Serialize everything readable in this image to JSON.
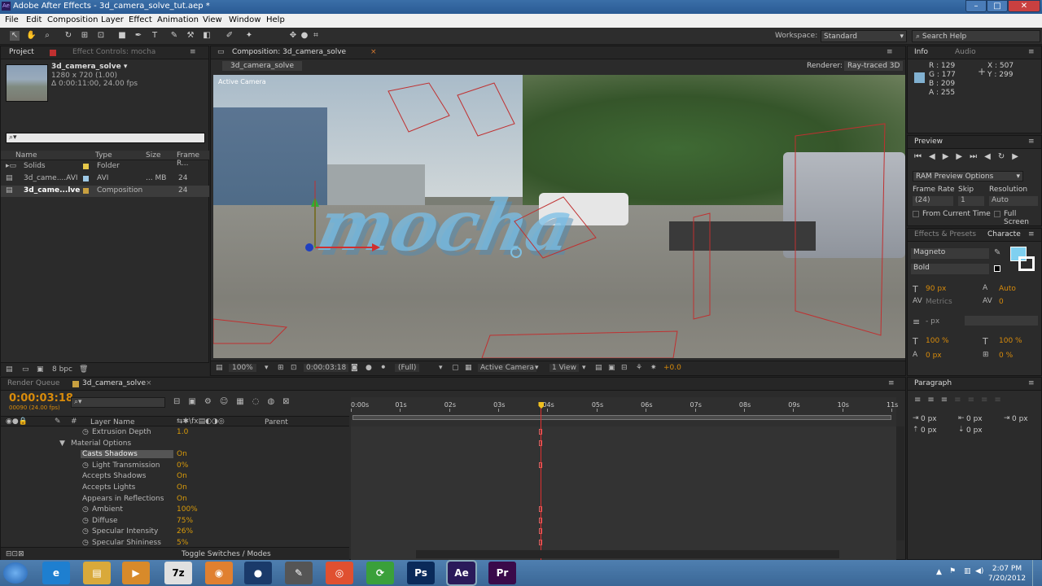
{
  "window": {
    "title": "Adobe After Effects - 3d_camera_solve_tut.aep *",
    "minimize": "–",
    "maximize": "□",
    "close": "✕"
  },
  "menu": [
    "File",
    "Edit",
    "Composition",
    "Layer",
    "Effect",
    "Animation",
    "View",
    "Window",
    "Help"
  ],
  "workspace": {
    "label": "Workspace:",
    "value": "Standard",
    "search_placeholder": "Search Help"
  },
  "project": {
    "tab1": "Project",
    "tab2": "Effect Controls: mocha",
    "comp_name": "3d_camera_solve ▾",
    "comp_info1": "1280 x 720 (1.00)",
    "comp_info2": "Δ 0:00:11:00, 24.00 fps",
    "headers": [
      "Name",
      "Type",
      "Size",
      "Frame R..."
    ],
    "items": [
      {
        "name": "Solids",
        "type": "Folder",
        "size": "",
        "fr": "",
        "color": "#e6c84a"
      },
      {
        "name": "3d_came....AVI",
        "type": "AVI",
        "size": "... MB",
        "fr": "24",
        "color": "#9ec9e6"
      },
      {
        "name": "3d_came...lve",
        "type": "Composition",
        "size": "",
        "fr": "24",
        "color": "#c8a040"
      }
    ],
    "bpc": "8 bpc"
  },
  "comp": {
    "tab": "Composition: 3d_camera_solve",
    "subtab": "3d_camera_solve",
    "renderer_label": "Renderer:",
    "renderer": "Ray-traced 3D",
    "active_camera": "Active Camera",
    "overlay_text": "mocha",
    "footer": {
      "zoom": "100%",
      "time": "0:00:03:18",
      "res": "(Full)",
      "camera": "Active Camera",
      "view": "1 View",
      "exposure": "+0.0"
    }
  },
  "info": {
    "tab1": "Info",
    "tab2": "Audio",
    "r": "R : 129",
    "g": "G : 177",
    "b": "B : 209",
    "a": "A : 255",
    "x": "X : 507",
    "y": "Y : 299",
    "swatch": "#81b1d1"
  },
  "preview": {
    "tab": "Preview",
    "ram": "RAM Preview Options",
    "frame_rate_label": "Frame Rate",
    "skip_label": "Skip",
    "resolution_label": "Resolution",
    "frame_rate": "(24)",
    "skip": "1",
    "resolution": "Auto",
    "from_current": "From Current Time",
    "full_screen": "Full Screen"
  },
  "character": {
    "tab1": "Effects & Presets",
    "tab2": "Characte",
    "font": "Magneto",
    "style": "Bold",
    "size": "90 px",
    "leading": "Auto",
    "kerning": "Metrics",
    "tracking": "0",
    "stroke": "- px",
    "vscale": "100 %",
    "hscale": "100 %",
    "baseline": "0 px",
    "tsume": "0 %",
    "fill_color": "#7fd0f0"
  },
  "timeline": {
    "tab1": "Render Queue",
    "tab2": "3d_camera_solve",
    "timecode": "0:00:03:18",
    "frames": "00090 (24.00 fps)",
    "col_layer": "Layer Name",
    "col_parent": "Parent",
    "toggle": "Toggle Switches / Modes",
    "ruler": [
      "0:00s",
      "01s",
      "02s",
      "03s",
      "04s",
      "05s",
      "06s",
      "07s",
      "08s",
      "09s",
      "10s",
      "11s"
    ],
    "playhead_fraction": 0.3485,
    "rows": [
      {
        "label": "Extrusion Depth",
        "value": "1.0",
        "indent": 3,
        "sw": true,
        "key": true
      },
      {
        "label": "Material Options",
        "value": "",
        "indent": 2,
        "sw": false,
        "key": true,
        "tri": true
      },
      {
        "label": "Casts Shadows",
        "value": "On",
        "indent": 3,
        "sw": false,
        "key": false,
        "sel": true
      },
      {
        "label": "Light Transmission",
        "value": "0%",
        "indent": 3,
        "sw": true,
        "key": true
      },
      {
        "label": "Accepts Shadows",
        "value": "On",
        "indent": 3,
        "sw": false,
        "key": false
      },
      {
        "label": "Accepts Lights",
        "value": "On",
        "indent": 3,
        "sw": false,
        "key": false
      },
      {
        "label": "Appears in Reflections",
        "value": "On",
        "indent": 3,
        "sw": false,
        "key": false
      },
      {
        "label": "Ambient",
        "value": "100%",
        "indent": 3,
        "sw": true,
        "key": true
      },
      {
        "label": "Diffuse",
        "value": "75%",
        "indent": 3,
        "sw": true,
        "key": true
      },
      {
        "label": "Specular Intensity",
        "value": "26%",
        "indent": 3,
        "sw": true,
        "key": true
      },
      {
        "label": "Specular Shininess",
        "value": "5%",
        "indent": 3,
        "sw": true,
        "key": true
      }
    ]
  },
  "paragraph": {
    "tab": "Paragraph",
    "v1": "0 px",
    "v2": "0 px",
    "v3": "0 px",
    "v4": "0 px",
    "v5": "0 px"
  },
  "taskbar": {
    "time": "2:07 PM",
    "date": "7/20/2012",
    "apps": [
      {
        "name": "ie",
        "label": "e",
        "color": "#1e7fd0"
      },
      {
        "name": "explorer",
        "label": "▤",
        "color": "#d9a93a"
      },
      {
        "name": "media",
        "label": "▶",
        "color": "#d88a2a"
      },
      {
        "name": "7zip",
        "label": "7z",
        "color": "#e0e0e0"
      },
      {
        "name": "blender",
        "label": "◉",
        "color": "#e08030"
      },
      {
        "name": "globe",
        "label": "●",
        "color": "#1a3a6a"
      },
      {
        "name": "app7",
        "label": "✎",
        "color": "#555"
      },
      {
        "name": "app8",
        "label": "◎",
        "color": "#e05030"
      },
      {
        "name": "app9",
        "label": "⟳",
        "color": "#3aa03a"
      },
      {
        "name": "photoshop",
        "label": "Ps",
        "color": "#0a2a5a"
      },
      {
        "name": "aftereffects",
        "label": "Ae",
        "color": "#2a1a5a"
      },
      {
        "name": "premiere",
        "label": "Pr",
        "color": "#3a0a4a"
      }
    ]
  }
}
